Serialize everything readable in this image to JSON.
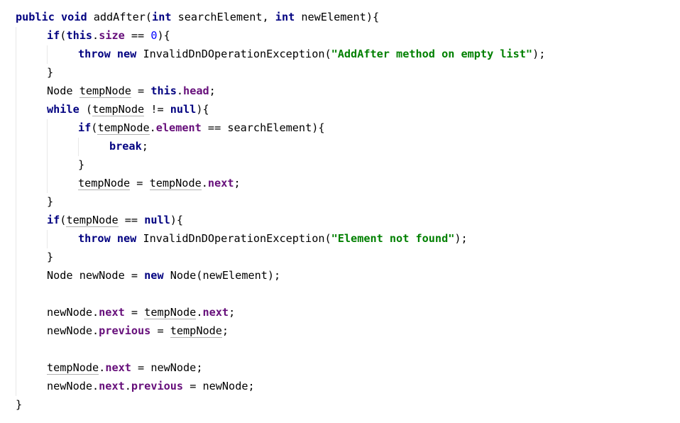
{
  "code": {
    "lines": [
      {
        "indent": 0,
        "tokens": [
          {
            "t": "public",
            "k": "kw"
          },
          {
            "t": " ",
            "k": "plain"
          },
          {
            "t": "void",
            "k": "kw"
          },
          {
            "t": " addAfter(",
            "k": "plain"
          },
          {
            "t": "int",
            "k": "kw"
          },
          {
            "t": " searchElement, ",
            "k": "plain"
          },
          {
            "t": "int",
            "k": "kw"
          },
          {
            "t": " newElement){",
            "k": "plain"
          }
        ]
      },
      {
        "indent": 1,
        "tokens": [
          {
            "t": "if",
            "k": "kw"
          },
          {
            "t": "(",
            "k": "plain"
          },
          {
            "t": "this",
            "k": "kw"
          },
          {
            "t": ".",
            "k": "plain"
          },
          {
            "t": "size",
            "k": "fld"
          },
          {
            "t": " == ",
            "k": "plain"
          },
          {
            "t": "0",
            "k": "num"
          },
          {
            "t": "){",
            "k": "plain"
          }
        ]
      },
      {
        "indent": 2,
        "tokens": [
          {
            "t": "throw",
            "k": "kw"
          },
          {
            "t": " ",
            "k": "plain"
          },
          {
            "t": "new",
            "k": "kw"
          },
          {
            "t": " InvalidDnDOperationException(",
            "k": "plain"
          },
          {
            "t": "\"AddAfter method on empty list\"",
            "k": "str"
          },
          {
            "t": ");",
            "k": "plain"
          }
        ]
      },
      {
        "indent": 1,
        "tokens": [
          {
            "t": "}",
            "k": "plain"
          }
        ]
      },
      {
        "indent": 1,
        "tokens": [
          {
            "t": "Node ",
            "k": "plain"
          },
          {
            "t": "tempNode",
            "k": "var"
          },
          {
            "t": " = ",
            "k": "plain"
          },
          {
            "t": "this",
            "k": "kw"
          },
          {
            "t": ".",
            "k": "plain"
          },
          {
            "t": "head",
            "k": "fld"
          },
          {
            "t": ";",
            "k": "plain"
          }
        ]
      },
      {
        "indent": 1,
        "tokens": [
          {
            "t": "while",
            "k": "kw"
          },
          {
            "t": " (",
            "k": "plain"
          },
          {
            "t": "tempNode",
            "k": "var"
          },
          {
            "t": " != ",
            "k": "plain"
          },
          {
            "t": "null",
            "k": "kw"
          },
          {
            "t": "){",
            "k": "plain"
          }
        ]
      },
      {
        "indent": 2,
        "tokens": [
          {
            "t": "if",
            "k": "kw"
          },
          {
            "t": "(",
            "k": "plain"
          },
          {
            "t": "tempNode",
            "k": "var"
          },
          {
            "t": ".",
            "k": "plain"
          },
          {
            "t": "element",
            "k": "fld"
          },
          {
            "t": " == searchElement){",
            "k": "plain"
          }
        ]
      },
      {
        "indent": 3,
        "tokens": [
          {
            "t": "break",
            "k": "kw"
          },
          {
            "t": ";",
            "k": "plain"
          }
        ]
      },
      {
        "indent": 2,
        "tokens": [
          {
            "t": "}",
            "k": "plain"
          }
        ]
      },
      {
        "indent": 2,
        "tokens": [
          {
            "t": "tempNode",
            "k": "var"
          },
          {
            "t": " = ",
            "k": "plain"
          },
          {
            "t": "tempNode",
            "k": "var"
          },
          {
            "t": ".",
            "k": "plain"
          },
          {
            "t": "next",
            "k": "fld"
          },
          {
            "t": ";",
            "k": "plain"
          }
        ]
      },
      {
        "indent": 1,
        "tokens": [
          {
            "t": "}",
            "k": "plain"
          }
        ]
      },
      {
        "indent": 1,
        "tokens": [
          {
            "t": "if",
            "k": "kw"
          },
          {
            "t": "(",
            "k": "plain"
          },
          {
            "t": "tempNode",
            "k": "var"
          },
          {
            "t": " == ",
            "k": "plain"
          },
          {
            "t": "null",
            "k": "kw"
          },
          {
            "t": "){",
            "k": "plain"
          }
        ]
      },
      {
        "indent": 2,
        "tokens": [
          {
            "t": "throw",
            "k": "kw"
          },
          {
            "t": " ",
            "k": "plain"
          },
          {
            "t": "new",
            "k": "kw"
          },
          {
            "t": " InvalidDnDOperationException(",
            "k": "plain"
          },
          {
            "t": "\"Element not found\"",
            "k": "str"
          },
          {
            "t": ");",
            "k": "plain"
          }
        ]
      },
      {
        "indent": 1,
        "tokens": [
          {
            "t": "}",
            "k": "plain"
          }
        ]
      },
      {
        "indent": 1,
        "tokens": [
          {
            "t": "Node newNode = ",
            "k": "plain"
          },
          {
            "t": "new",
            "k": "kw"
          },
          {
            "t": " Node(newElement);",
            "k": "plain"
          }
        ]
      },
      {
        "indent": 0,
        "tokens": []
      },
      {
        "indent": 1,
        "tokens": [
          {
            "t": "newNode.",
            "k": "plain"
          },
          {
            "t": "next",
            "k": "fld"
          },
          {
            "t": " = ",
            "k": "plain"
          },
          {
            "t": "tempNode",
            "k": "var"
          },
          {
            "t": ".",
            "k": "plain"
          },
          {
            "t": "next",
            "k": "fld"
          },
          {
            "t": ";",
            "k": "plain"
          }
        ]
      },
      {
        "indent": 1,
        "tokens": [
          {
            "t": "newNode.",
            "k": "plain"
          },
          {
            "t": "previous",
            "k": "fld"
          },
          {
            "t": " = ",
            "k": "plain"
          },
          {
            "t": "tempNode",
            "k": "var"
          },
          {
            "t": ";",
            "k": "plain"
          }
        ]
      },
      {
        "indent": 0,
        "tokens": []
      },
      {
        "indent": 1,
        "tokens": [
          {
            "t": "tempNode",
            "k": "var"
          },
          {
            "t": ".",
            "k": "plain"
          },
          {
            "t": "next",
            "k": "fld"
          },
          {
            "t": " = newNode;",
            "k": "plain"
          }
        ]
      },
      {
        "indent": 1,
        "tokens": [
          {
            "t": "newNode.",
            "k": "plain"
          },
          {
            "t": "next",
            "k": "fld"
          },
          {
            "t": ".",
            "k": "plain"
          },
          {
            "t": "previous",
            "k": "fld"
          },
          {
            "t": " = newNode;",
            "k": "plain"
          }
        ]
      },
      {
        "indent": 0,
        "tokens": [
          {
            "t": "}",
            "k": "plain"
          }
        ]
      }
    ]
  }
}
